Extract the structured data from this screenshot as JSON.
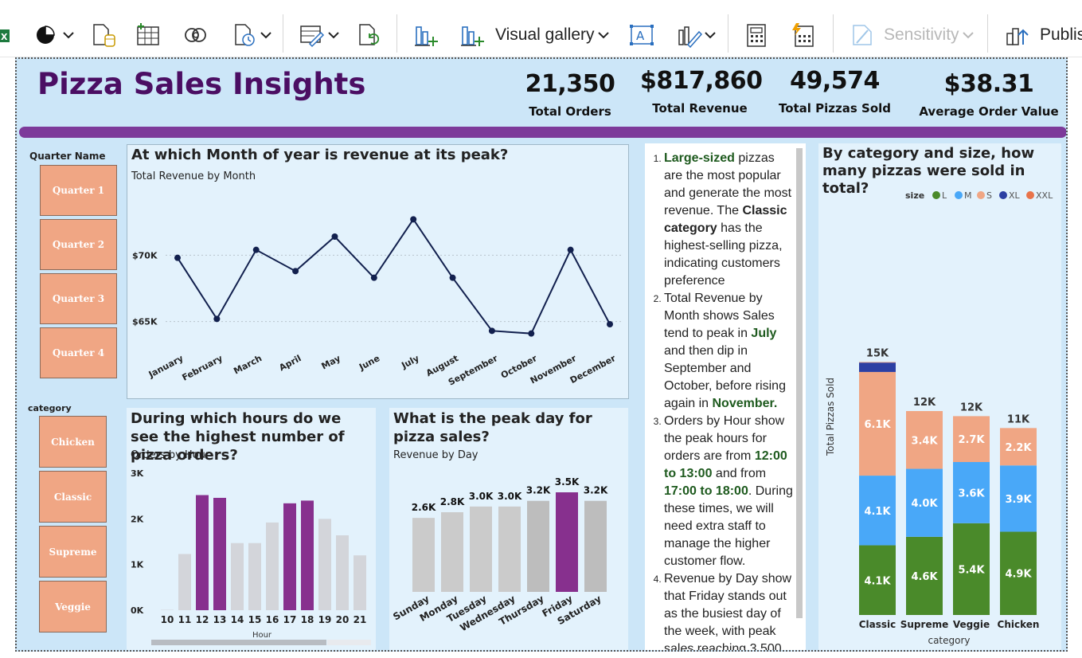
{
  "ribbon": {
    "visual_gallery": "Visual gallery",
    "sensitivity": "Sensitivity",
    "publish": "Publis"
  },
  "dashboard": {
    "title": "Pizza Sales Insights",
    "kpis": [
      {
        "value": "21,350",
        "label": "Total Orders"
      },
      {
        "value": "$817,860",
        "label": "Total Revenue"
      },
      {
        "value": "49,574",
        "label": "Total Pizzas Sold"
      },
      {
        "value": "$38.31",
        "label": "Average Order Value"
      }
    ],
    "accent_color": "#7d3a9a",
    "title_color": "#4b0e63"
  },
  "slicers": {
    "quarter": {
      "label": "Quarter Name",
      "items": [
        "Quarter 1",
        "Quarter 2",
        "Quarter 3",
        "Quarter 4"
      ]
    },
    "category": {
      "label": "category",
      "items": [
        "Chicken",
        "Classic",
        "Supreme",
        "Veggie"
      ]
    }
  },
  "charts": {
    "monthly": {
      "title": "At which Month of year is revenue at its peak?",
      "subtitle": "Total Revenue by Month"
    },
    "hourly": {
      "title": "During which hours do we see the highest number of pizza orders?",
      "subtitle": "Orders by Hour",
      "xlabel": "Hour"
    },
    "daily": {
      "title": "What is the peak day for pizza sales?",
      "subtitle": "Revenue by Day"
    },
    "size": {
      "title": "By category and size, how many pizzas were sold in total?",
      "ylabel": "Total Pizzas Sold",
      "xlabel": "category",
      "legend_title": "size"
    }
  },
  "insights": [
    {
      "parts": [
        {
          "t": "Large-sized",
          "b": true,
          "g": true
        },
        {
          "t": " pizzas are the most popular and generate the most revenue. The "
        },
        {
          "t": "Classic category",
          "b": true
        },
        {
          "t": " has the highest-selling pizza, indicating customers preference"
        }
      ]
    },
    {
      "parts": [
        {
          "t": "Total Revenue by Month shows Sales tend to peak in "
        },
        {
          "t": "July",
          "b": true,
          "g": true
        },
        {
          "t": " and then dip in September and October, before rising again in "
        },
        {
          "t": "November.",
          "b": true,
          "g": true
        }
      ]
    },
    {
      "parts": [
        {
          "t": "Orders by Hour show the peak hours for orders are from "
        },
        {
          "t": "12:00 to 13:00",
          "b": true,
          "g": true
        },
        {
          "t": " and from "
        },
        {
          "t": "17:00 to 18:00",
          "b": true,
          "g": true
        },
        {
          "t": ". During these times, we will need extra staff to manage the higher customer flow."
        }
      ]
    },
    {
      "parts": [
        {
          "t": "Revenue by Day show that Friday stands out as the busiest day of the week, with peak sales reaching 3,500"
        }
      ]
    }
  ],
  "chart_data": [
    {
      "type": "line",
      "title": "At which Month of year is revenue at its peak?",
      "subtitle": "Total Revenue by Month",
      "categories": [
        "January",
        "February",
        "March",
        "April",
        "May",
        "June",
        "July",
        "August",
        "September",
        "October",
        "November",
        "December"
      ],
      "values": [
        69800,
        65200,
        70400,
        68800,
        71400,
        68300,
        72700,
        68300,
        64300,
        64100,
        70400,
        64800
      ],
      "yticks": [
        "$65K",
        "$70K"
      ],
      "ylim": [
        63000,
        73500
      ],
      "line_color": "#12204e",
      "grid": true
    },
    {
      "type": "bar",
      "title": "During which hours do we see the highest number of pizza orders?",
      "subtitle": "Orders by Hour",
      "xlabel": "Hour",
      "categories": [
        "10",
        "11",
        "12",
        "13",
        "14",
        "15",
        "16",
        "17",
        "18",
        "19",
        "20",
        "21"
      ],
      "values": [
        8,
        1230,
        2520,
        2460,
        1470,
        1470,
        1920,
        2340,
        2400,
        2000,
        1640,
        1200
      ],
      "highlight": [
        "12",
        "13",
        "17",
        "18"
      ],
      "yticks": [
        "0K",
        "1K",
        "2K",
        "3K"
      ],
      "ylim": [
        0,
        3000
      ],
      "highlight_color": "#87308e",
      "base_color": "#d3d5da"
    },
    {
      "type": "bar",
      "title": "What is the peak day for pizza sales?",
      "subtitle": "Revenue by Day",
      "categories": [
        "Sunday",
        "Monday",
        "Tuesday",
        "Wednesday",
        "Thursday",
        "Friday",
        "Saturday"
      ],
      "values": [
        2600,
        2800,
        3000,
        3000,
        3200,
        3500,
        3200
      ],
      "labels": [
        "2.6K",
        "2.8K",
        "3.0K",
        "3.0K",
        "3.2K",
        "3.5K",
        "3.2K"
      ],
      "highlight": [
        "Friday"
      ],
      "highlight_color": "#87308e",
      "base_color": "#cbcbcb",
      "ylim": [
        0,
        3500
      ]
    },
    {
      "type": "bar",
      "stacked": true,
      "title": "By category and size, how many pizzas were sold in total?",
      "xlabel": "category",
      "ylabel": "Total Pizzas Sold",
      "categories": [
        "Classic",
        "Supreme",
        "Veggie",
        "Chicken"
      ],
      "totals": [
        "15K",
        "12K",
        "12K",
        "11K"
      ],
      "series": [
        {
          "name": "L",
          "color": "#4a8a2a",
          "values": [
            4100,
            4600,
            5400,
            4900
          ],
          "labels": [
            "4.1K",
            "4.6K",
            "5.4K",
            "4.9K"
          ]
        },
        {
          "name": "M",
          "color": "#49a8f8",
          "values": [
            4100,
            4000,
            3600,
            3900
          ],
          "labels": [
            "4.1K",
            "4.0K",
            "3.6K",
            "3.9K"
          ]
        },
        {
          "name": "S",
          "color": "#f0a684",
          "values": [
            6100,
            3400,
            2700,
            2200
          ],
          "labels": [
            "6.1K",
            "3.4K",
            "2.7K",
            "2.2K"
          ]
        },
        {
          "name": "XL",
          "color": "#2c3fa3",
          "values": [
            550,
            0,
            0,
            0
          ],
          "labels": [
            "",
            "",
            "",
            ""
          ]
        },
        {
          "name": "XXL",
          "color": "#e8734a",
          "values": [
            28,
            0,
            0,
            0
          ],
          "labels": [
            "",
            "",
            "",
            ""
          ]
        }
      ],
      "ylim": [
        0,
        15000
      ],
      "legend_position": "top-right"
    }
  ]
}
